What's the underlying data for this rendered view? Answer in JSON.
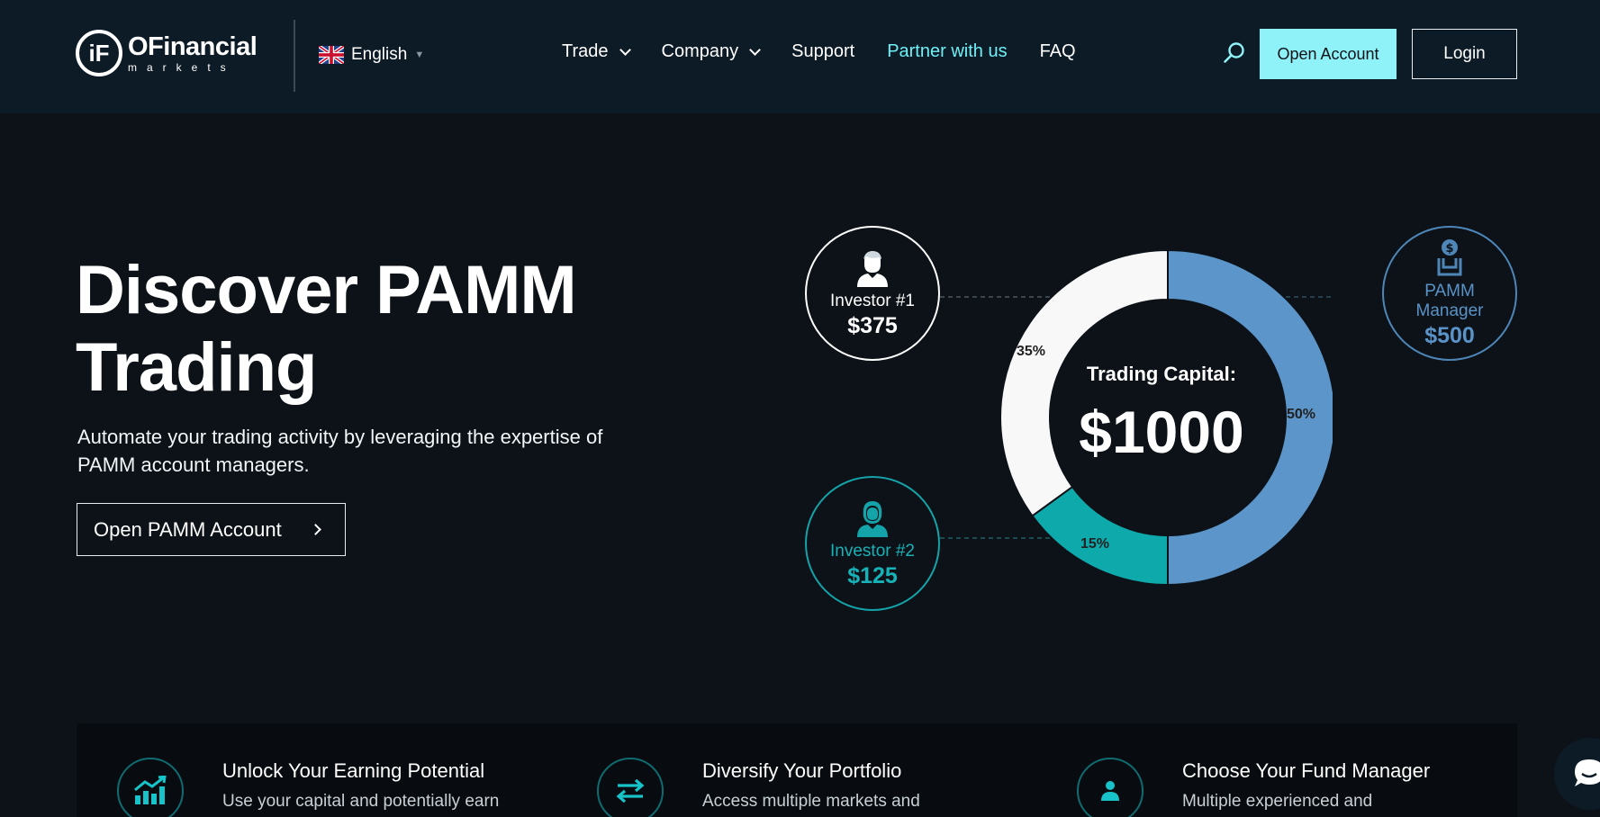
{
  "header": {
    "logo_name": "OFinancial",
    "logo_sub": "markets",
    "logo_mark": "iF",
    "language": "English",
    "nav": [
      {
        "label": "Trade"
      },
      {
        "label": "Company"
      },
      {
        "label": "Support"
      },
      {
        "label": "Partner with us"
      },
      {
        "label": "FAQ"
      }
    ],
    "open_account": "Open Account",
    "login": "Login"
  },
  "hero": {
    "title_line1": "Discover PAMM",
    "title_line2": "Trading",
    "subtitle": "Automate your trading activity by leveraging the expertise of PAMM account managers.",
    "button": "Open PAMM Account"
  },
  "pamm_chart": {
    "center_label": "Trading Capital:",
    "center_value": "$1000",
    "segments": [
      {
        "name": "PAMM Manager",
        "percent": 50,
        "label": "50%",
        "color": "#5b95c9"
      },
      {
        "name": "Investor #2",
        "percent": 15,
        "label": "15%",
        "color": "#0ea9ab"
      },
      {
        "name": "Investor #1",
        "percent": 35,
        "label": "35%",
        "color": "#f8f8f8"
      }
    ],
    "investor1": {
      "label": "Investor #1",
      "value": "$375"
    },
    "investor2": {
      "label": "Investor #2",
      "value": "$125"
    },
    "manager": {
      "label_line1": "PAMM",
      "label_line2": "Manager",
      "value": "$500"
    }
  },
  "features": [
    {
      "title": "Unlock Your Earning Potential",
      "text": "Use your capital and potentially earn",
      "icon": "chart-growth-icon"
    },
    {
      "title": "Diversify Your Portfolio",
      "text": "Access multiple markets and",
      "icon": "swap-arrows-icon"
    },
    {
      "title": "Choose Your Fund Manager",
      "text": "Multiple experienced and",
      "icon": "manager-icon"
    }
  ],
  "colors": {
    "accent": "#8ff2f8",
    "teal": "#0ea9ab",
    "blue": "#5b95c9",
    "background": "#0c1218"
  }
}
